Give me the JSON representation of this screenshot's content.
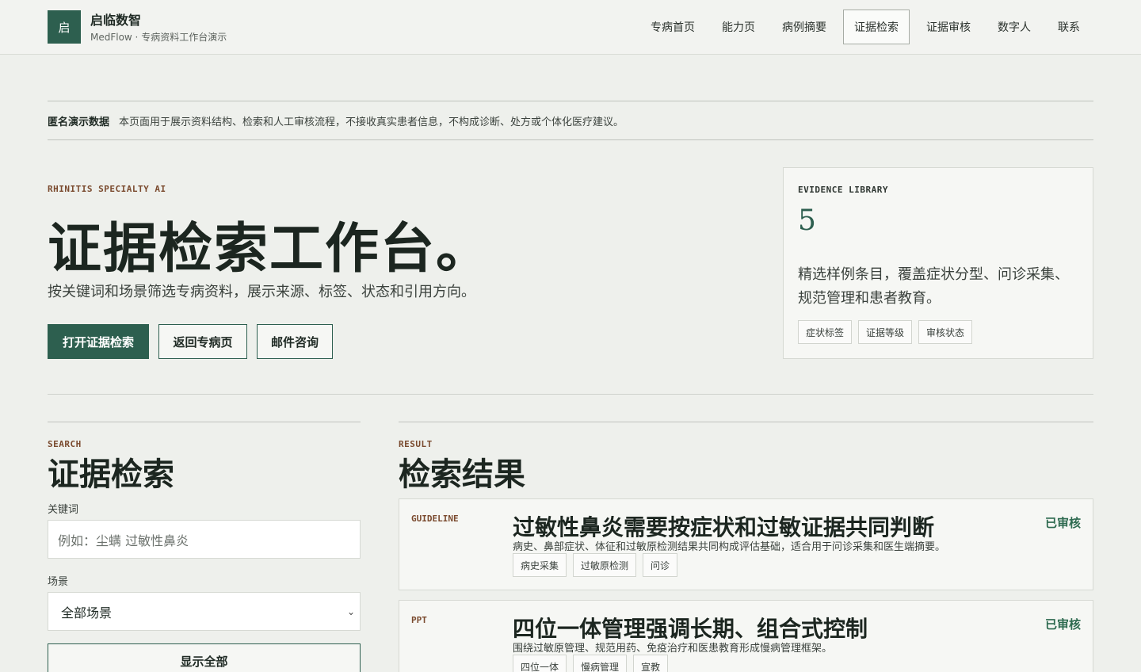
{
  "header": {
    "logo_char": "启",
    "brand_name": "启临数智",
    "brand_sub": "MedFlow · 专病资料工作台演示",
    "nav": [
      "专病首页",
      "能力页",
      "病例摘要",
      "证据检索",
      "证据审核",
      "数字人",
      "联系"
    ],
    "active_nav": "证据检索"
  },
  "notice": {
    "label": "匿名演示数据",
    "text": "本页面用于展示资料结构、检索和人工审核流程，不接收真实患者信息，不构成诊断、处方或个体化医疗建议。"
  },
  "hero": {
    "eyebrow": "RHINITIS SPECIALTY AI",
    "title": "证据检索工作台。",
    "subtitle": "按关键词和场景筛选专病资料，展示来源、标签、状态和引用方向。",
    "buttons": [
      "打开证据检索",
      "返回专病页",
      "邮件咨询"
    ]
  },
  "evidence_card": {
    "eyebrow": "EVIDENCE LIBRARY",
    "count": "5",
    "description": "精选样例条目，覆盖症状分型、问诊采集、规范管理和患者教育。",
    "chips": [
      "症状标签",
      "证据等级",
      "审核状态"
    ]
  },
  "search": {
    "eyebrow": "SEARCH",
    "title": "证据检索",
    "keyword_label": "关键词",
    "keyword_placeholder": "例如：尘螨 过敏性鼻炎",
    "scene_label": "场景",
    "scene_value": "全部场景",
    "show_all": "显示全部"
  },
  "results": {
    "eyebrow": "RESULT",
    "title": "检索结果",
    "items": [
      {
        "type": "GUIDELINE",
        "title": "过敏性鼻炎需要按症状和过敏证据共同判断",
        "desc": "病史、鼻部症状、体征和过敏原检测结果共同构成评估基础，适合用于问诊采集和医生端摘要。",
        "tags": [
          "病史采集",
          "过敏原检测",
          "问诊"
        ],
        "status": "已审核"
      },
      {
        "type": "PPT",
        "title": "四位一体管理强调长期、组合式控制",
        "desc": "围绕过敏原管理、规范用药、免疫治疗和医患教育形成慢病管理框架。",
        "tags": [
          "四位一体",
          "慢病管理",
          "宣教"
        ],
        "status": "已审核"
      }
    ]
  }
}
